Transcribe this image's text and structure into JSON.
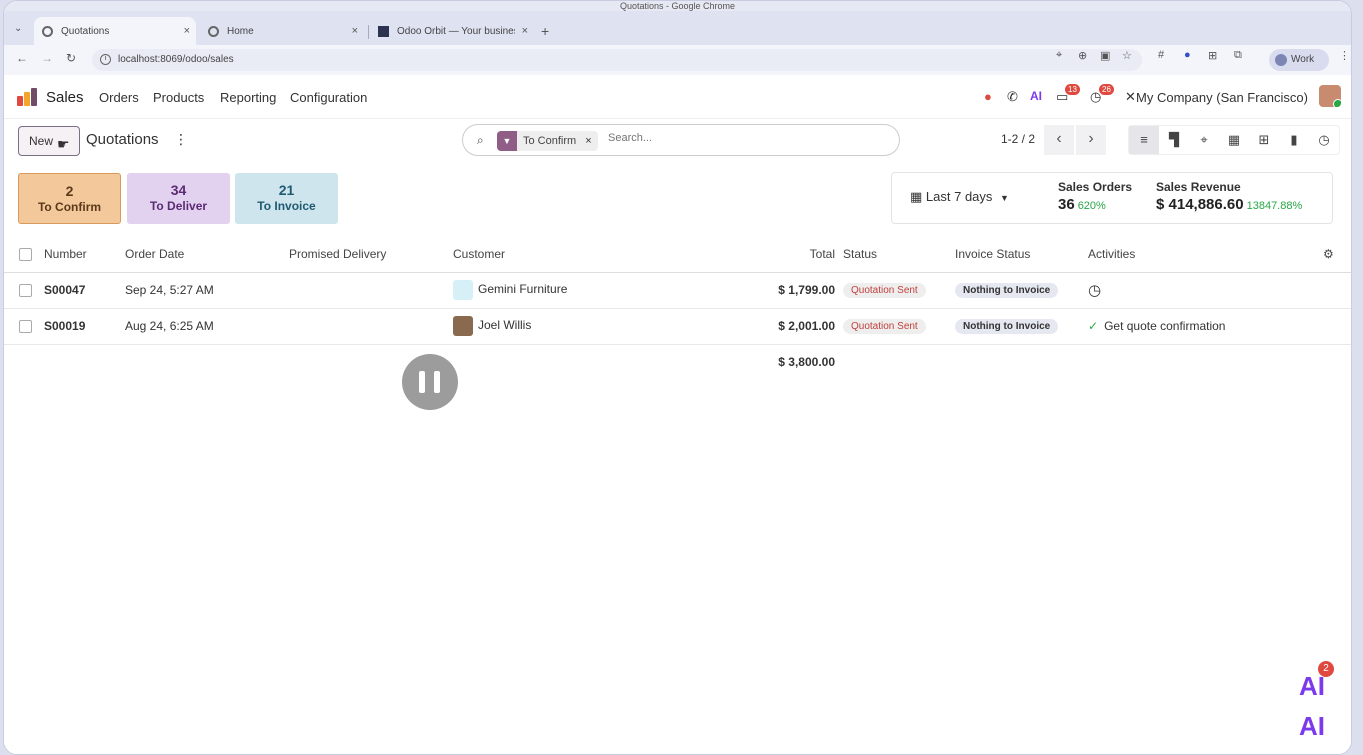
{
  "browser": {
    "window_title": "Quotations - Google Chrome",
    "tabs": [
      {
        "title": "Quotations",
        "active": true
      },
      {
        "title": "Home",
        "active": false
      },
      {
        "title": "Odoo Orbit — Your busines",
        "active": false
      }
    ],
    "url": "localhost:8069/odoo/sales",
    "profile_label": "Work"
  },
  "navbar": {
    "app_name": "Sales",
    "menus": [
      "Orders",
      "Products",
      "Reporting",
      "Configuration"
    ],
    "messages_badge": "13",
    "activities_badge": "26",
    "company": "My Company (San Francisco)"
  },
  "control_panel": {
    "new_button": "New",
    "breadcrumb": "Quotations",
    "filter_facet": "To Confirm",
    "search_placeholder": "Search...",
    "pager": "1-2 / 2"
  },
  "dashboard": {
    "cards": [
      {
        "count": "2",
        "label": "To Confirm",
        "bg": "#f3c89a",
        "fg": "#5a3a1a"
      },
      {
        "count": "34",
        "label": "To Deliver",
        "bg": "#e3d2ef",
        "fg": "#5b2b74"
      },
      {
        "count": "21",
        "label": "To Invoice",
        "bg": "#cfe5ee",
        "fg": "#1f5a70"
      }
    ],
    "period": "Last 7 days",
    "kpis": [
      {
        "title": "Sales Orders",
        "value": "36",
        "change": "620%"
      },
      {
        "title": "Sales Revenue",
        "value": "$ 414,886.60",
        "change": "13847.88%"
      }
    ]
  },
  "table": {
    "columns": [
      "Number",
      "Order Date",
      "Promised Delivery",
      "Customer",
      "Total",
      "Status",
      "Invoice Status",
      "Activities"
    ],
    "rows": [
      {
        "number": "S00047",
        "order_date": "Sep 24, 5:27 AM",
        "promised": "",
        "customer": "Gemini Furniture",
        "total": "$ 1,799.00",
        "status": "Quotation Sent",
        "invoice_status": "Nothing to Invoice",
        "activity": ""
      },
      {
        "number": "S00019",
        "order_date": "Aug 24, 6:25 AM",
        "promised": "",
        "customer": "Joel Willis",
        "total": "$ 2,001.00",
        "status": "Quotation Sent",
        "invoice_status": "Nothing to Invoice",
        "activity": "Get quote confirmation"
      }
    ],
    "grand_total": "$ 3,800.00"
  },
  "ai_widget": {
    "label": "AI",
    "badge": "2"
  },
  "colors": {
    "brand": "#714b67",
    "positive": "#28a745",
    "badge": "#e0493f"
  }
}
